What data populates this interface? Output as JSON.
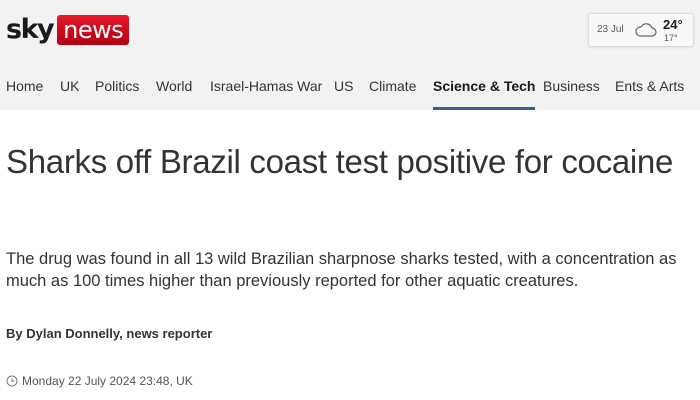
{
  "logo": {
    "sky": "sky",
    "news": "news"
  },
  "weather": {
    "date": "23 Jul",
    "icon": "cloud-icon",
    "high": "24°",
    "low": "17°"
  },
  "nav": {
    "items": [
      {
        "label": "Home"
      },
      {
        "label": "UK"
      },
      {
        "label": "Politics"
      },
      {
        "label": "World"
      },
      {
        "label": "Israel-Hamas War"
      },
      {
        "label": "US"
      },
      {
        "label": "Climate"
      },
      {
        "label": "Science & Tech",
        "active": true
      },
      {
        "label": "Business"
      },
      {
        "label": "Ents & Arts"
      }
    ]
  },
  "article": {
    "headline": "Sharks off Brazil coast test positive for cocaine",
    "standfirst": "The drug was found in all 13 wild Brazilian sharpnose sharks tested, with a concentration as much as 100 times higher than previously reported for other aquatic creatures.",
    "byline": "By Dylan Donnelly, news reporter",
    "timestamp": "Monday 22 July 2024 23:48, UK"
  },
  "colors": {
    "brand_red": "#e8192c",
    "nav_active_underline": "#3c5a9a",
    "header_bg": "#f2f2f2"
  }
}
